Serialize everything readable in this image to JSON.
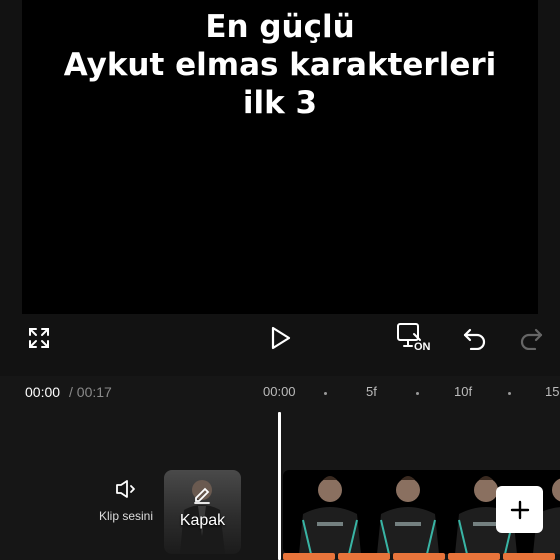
{
  "preview": {
    "overlay_lines": [
      "En güçlü",
      "Aykut elmas karakterleri",
      "ilk 3"
    ]
  },
  "toolbar": {
    "fullscreen_icon": "expand-icon",
    "play_icon": "play-icon",
    "toggle_icon": "original-toggle-icon",
    "toggle_badge": "ON",
    "undo_icon": "undo-icon",
    "redo_icon": "redo-icon"
  },
  "timeline": {
    "current_time": "00:00",
    "total_time": "/ 00:17",
    "ruler_labels": [
      "00:00",
      "5f",
      "10f",
      "15"
    ]
  },
  "track": {
    "clip_audio_label": "Klip sesini",
    "cover_label": "Kapak",
    "add_icon": "plus-icon"
  },
  "colors": {
    "background": "#121212",
    "canvas": "#000000",
    "audio_strip": "#e8743b",
    "playhead": "#ffffff"
  }
}
